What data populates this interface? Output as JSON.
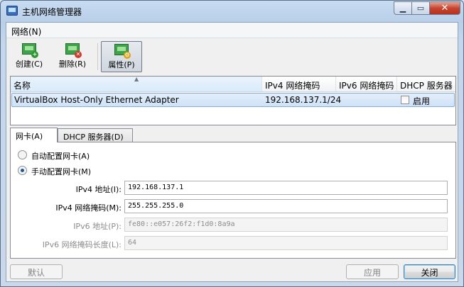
{
  "window": {
    "title": "主机网络管理器"
  },
  "menu": {
    "network": "网络(N)"
  },
  "toolbar": {
    "create": "创建(C)",
    "delete": "删除(R)",
    "properties": "属性(P)"
  },
  "table": {
    "headers": [
      "名称",
      "IPv4 网络掩码",
      "IPv6 网络掩码",
      "DHCP 服务器"
    ],
    "rows": [
      {
        "name": "VirtualBox Host-Only Ethernet Adapter",
        "ipv4": "192.168.137.1/24",
        "ipv6": "",
        "dhcp_label": "启用",
        "dhcp_enabled": false
      }
    ]
  },
  "tabs": {
    "adapter": "网卡(A)",
    "dhcp": "DHCP 服务器(D)"
  },
  "adapter": {
    "auto_label": "自动配置网卡(A)",
    "manual_label": "手动配置网卡(M)",
    "selected": "manual",
    "ipv4_addr_label": "IPv4 地址(I):",
    "ipv4_addr": "192.168.137.1",
    "ipv4_mask_label": "IPv4 网络掩码(M):",
    "ipv4_mask": "255.255.255.0",
    "ipv6_addr_label": "IPv6 地址(P):",
    "ipv6_addr": "fe80::e057:26f2:f1d0:8a9a",
    "ipv6_prefix_label": "IPv6 网络掩码长度(L):",
    "ipv6_prefix": "64"
  },
  "buttons": {
    "reset": "默认",
    "apply": "应用",
    "close": "关闭"
  },
  "colors": {
    "accent": "#1c5a9e",
    "selection": "#cfe2f8",
    "close_button": "#c6452f"
  }
}
